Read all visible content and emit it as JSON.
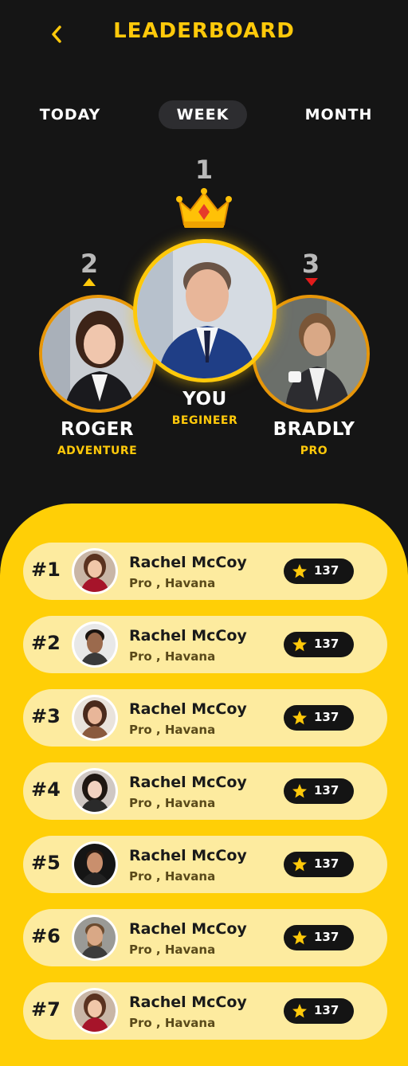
{
  "header": {
    "title": "LEADERBOARD",
    "accent": "#ffc90a"
  },
  "tabs": [
    {
      "label": "TODAY",
      "active": false
    },
    {
      "label": "WEEK",
      "active": true
    },
    {
      "label": "MONTH",
      "active": false
    }
  ],
  "podium": {
    "first": {
      "rank": "1",
      "name": "YOU",
      "level": "BEGINEER"
    },
    "second": {
      "rank": "2",
      "name": "ROGER",
      "level": "ADVENTURE",
      "trend": "up"
    },
    "third": {
      "rank": "3",
      "name": "BRADLY",
      "level": "PRO",
      "trend": "down"
    }
  },
  "list": [
    {
      "rank": "#1",
      "name": "Rachel McCoy",
      "sub": "Pro , Havana",
      "score": "137"
    },
    {
      "rank": "#2",
      "name": "Rachel McCoy",
      "sub": "Pro , Havana",
      "score": "137"
    },
    {
      "rank": "#3",
      "name": "Rachel McCoy",
      "sub": "Pro , Havana",
      "score": "137"
    },
    {
      "rank": "#4",
      "name": "Rachel McCoy",
      "sub": "Pro , Havana",
      "score": "137"
    },
    {
      "rank": "#5",
      "name": "Rachel McCoy",
      "sub": "Pro , Havana",
      "score": "137"
    },
    {
      "rank": "#6",
      "name": "Rachel McCoy",
      "sub": "Pro , Havana",
      "score": "137"
    },
    {
      "rank": "#7",
      "name": "Rachel McCoy",
      "sub": "Pro , Havana",
      "score": "137"
    }
  ]
}
